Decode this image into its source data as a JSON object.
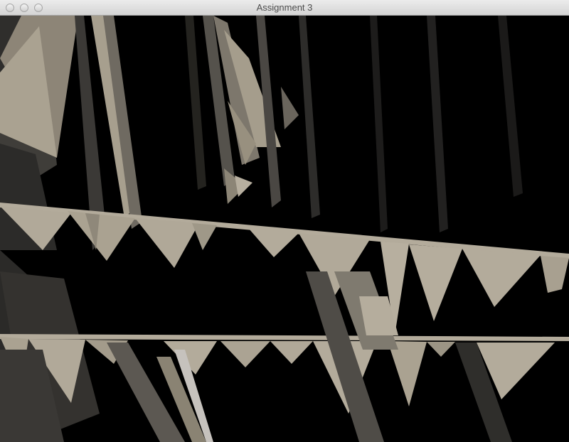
{
  "window": {
    "title": "Assignment 3",
    "controls": [
      "close-button",
      "minimize-button",
      "zoom-button"
    ]
  },
  "scene": {
    "description_color_light": "#b3ab9b",
    "description_color_mid": "#6f6a61",
    "description_color_dark": "#3a3835",
    "background": "#000000"
  }
}
